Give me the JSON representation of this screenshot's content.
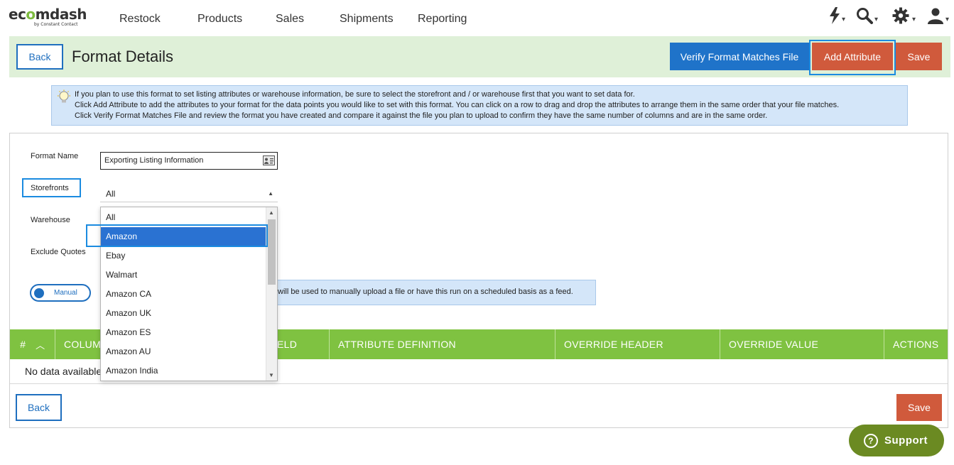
{
  "brand": {
    "name_pre": "ec",
    "name_o": "o",
    "name_post": "mdash",
    "tagline": "by Constant Contact"
  },
  "nav": {
    "items": [
      "Restock",
      "Products",
      "Sales",
      "Shipments",
      "Reporting"
    ]
  },
  "header": {
    "back_label": "Back",
    "title": "Format Details",
    "verify_label": "Verify Format Matches File",
    "add_attribute_label": "Add Attribute",
    "save_label": "Save"
  },
  "info": {
    "lines": [
      "If you plan to use this format to set listing attributes or warehouse information, be sure to select the storefront and / or warehouse first that you want to set data for.",
      "Click Add Attribute to add the attributes to your format for the data points you would like to set with this format. You can click on a row to drag and drop the attributes to arrange them in the same order that your file matches.",
      "Click Verify Format Matches File and review the format you have created and compare it against the file you plan to upload to confirm they have the same number of columns and are in the same order."
    ]
  },
  "form": {
    "format_name_label": "Format Name",
    "format_name_value": "Exporting Listing Information",
    "storefronts_label": "Storefronts",
    "storefronts_value": "All",
    "warehouse_label": "Warehouse",
    "exclude_quotes_label": "Exclude Quotes",
    "toggle_label": "Manual",
    "toggle_note": "will be used to manually upload a file or have this run on a scheduled basis as a feed."
  },
  "dropdown": {
    "options": [
      "All",
      "Amazon",
      "Ebay",
      "Walmart",
      "Amazon CA",
      "Amazon UK",
      "Amazon ES",
      "Amazon AU",
      "Amazon India"
    ],
    "selected": "Amazon"
  },
  "table": {
    "columns": [
      "#",
      "COLUM",
      "ELD",
      "ATTRIBUTE DEFINITION",
      "OVERRIDE HEADER",
      "OVERRIDE VALUE",
      "ACTIONS"
    ],
    "empty_text": "No data available"
  },
  "footer": {
    "back_label": "Back",
    "save_label": "Save"
  },
  "support": {
    "label": "Support",
    "icon_glyph": "?"
  },
  "colors": {
    "green_header": "#7fc241",
    "blue": "#1f73c9",
    "orange": "#d05a3c",
    "titlebar": "#dff0d8",
    "support": "#6b8a22"
  }
}
